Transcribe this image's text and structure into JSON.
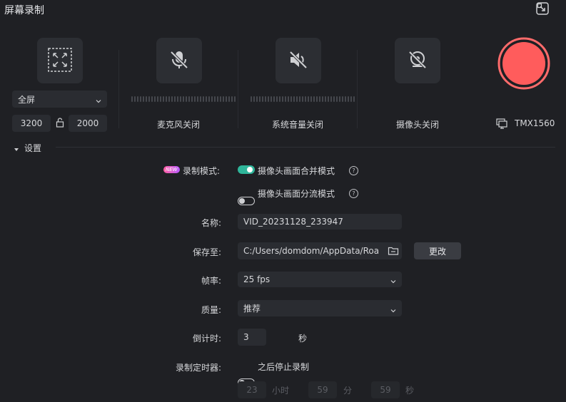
{
  "header": {
    "title": "屏幕录制"
  },
  "sources": {
    "screen": {
      "mode_value": "全屏",
      "width": "3200",
      "height": "2000"
    },
    "mic": {
      "label": "麦克风关闭"
    },
    "system_audio": {
      "label": "系统音量关闭"
    },
    "camera": {
      "label": "摄像头关闭"
    },
    "display": {
      "label": "TMX1560"
    }
  },
  "settings": {
    "section_label": "设置",
    "new_badge": "NEW",
    "record_mode_label": "录制模式:",
    "mode_merge_label": "摄像头画面合并模式",
    "mode_merge_on": true,
    "mode_split_label": "摄像头画面分流模式",
    "mode_split_on": false,
    "help_glyph": "?",
    "name_label": "名称:",
    "name_value": "VID_20231128_233947",
    "save_label": "保存至:",
    "save_value": "C:/Users/domdom/AppData/Roa",
    "change_button": "更改",
    "fps_label": "帧率:",
    "fps_value": "25 fps",
    "quality_label": "质量:",
    "quality_value": "推荐",
    "countdown_label": "倒计时:",
    "countdown_value": "3",
    "countdown_unit": "秒",
    "timer_label": "录制定时器:",
    "timer_toggle_label": "之后停止录制",
    "timer_on": false,
    "hours_value": "23",
    "hours_unit": "小时",
    "minutes_value": "59",
    "minutes_unit": "分",
    "seconds_value": "59",
    "seconds_unit": "秒"
  },
  "colors": {
    "accent": "#2fb59a",
    "record": "#ff5c5c",
    "background": "#1f2024"
  }
}
